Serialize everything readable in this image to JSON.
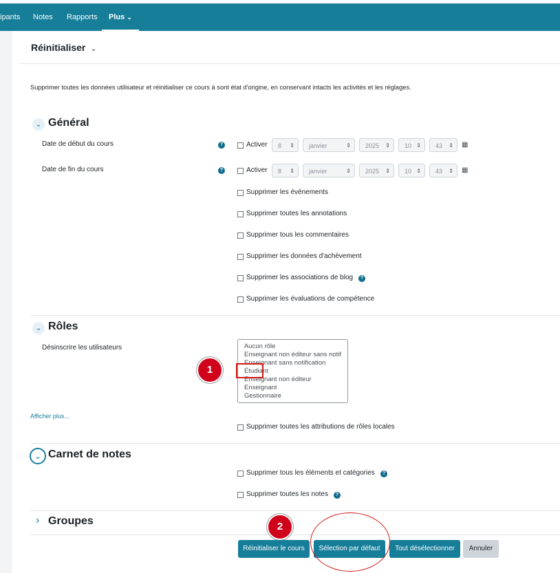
{
  "nav": {
    "items": [
      "ipants",
      "Notes",
      "Rapports",
      "Plus"
    ],
    "active_caret": "⌄"
  },
  "header": {
    "title": "Réinitialiser",
    "caret": "⌄"
  },
  "intro": "Supprimer toutes les données utilisateur et réinitialiser ce cours à sont état d'origine, en conservant intacts les activités et les réglages.",
  "general": {
    "heading": "Général",
    "start_label": "Date de début du cours",
    "end_label": "Date de fin du cours",
    "enable_label": "Activer",
    "date": {
      "day": "8",
      "month": "janvier",
      "year": "2025",
      "hour": "10",
      "minute": "43"
    },
    "options": [
      "Supprimer les événements",
      "Supprimer toutes les annotations",
      "Supprimer tous les commentaires",
      "Supprimer les données d'achèvement",
      "Supprimer les associations de blog",
      "Supprimer les évaluations de compétence"
    ]
  },
  "roles": {
    "heading": "Rôles",
    "unenrol_label": "Désinscrire les utilisateurs",
    "options": [
      "Aucun rôle",
      "Enseignant non éditeur sans notif",
      "Enseignant sans notification",
      "Étudiant",
      "Enseignant non éditeur",
      "Enseignant",
      "Gestionnaire"
    ],
    "show_more": "Afficher plus...",
    "local_roles": "Supprimer toutes les attributions de rôles locales"
  },
  "gradebook": {
    "heading": "Carnet de notes",
    "options": [
      "Supprimer tous les éléments et catégories",
      "Supprimer toutes les notes"
    ]
  },
  "groups": {
    "heading": "Groupes"
  },
  "annotations": {
    "badge1": "1",
    "badge2": "2"
  },
  "buttons": {
    "reset": "Réinitialiser le cours",
    "default": "Sélection par défaut",
    "deselect": "Tout désélectionner",
    "cancel": "Annuler"
  },
  "icons": {
    "help": "?",
    "calendar": "▦",
    "chevron_down": "⌄",
    "chevron_right": "›",
    "select_arrows": "⇕"
  },
  "colors": {
    "primary": "#177e99",
    "annotation_red": "#d0021b"
  }
}
